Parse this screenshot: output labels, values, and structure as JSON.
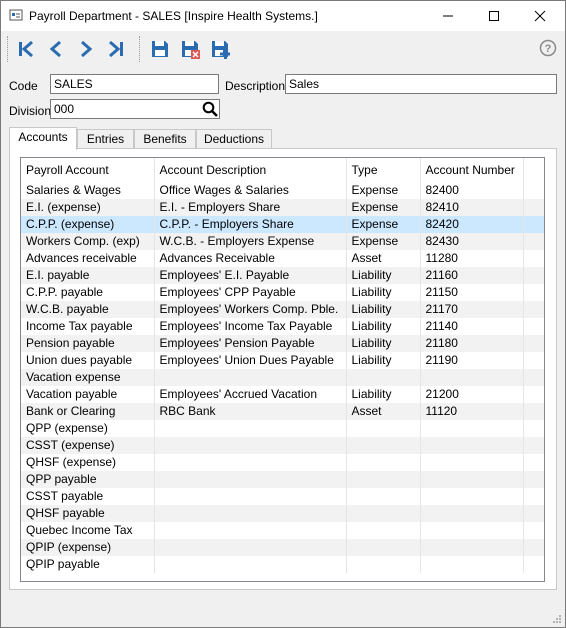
{
  "window": {
    "title": "Payroll Department - SALES [Inspire Health Systems.]",
    "controls": [
      "minimize",
      "maximize",
      "close"
    ]
  },
  "toolbar": {
    "buttons": [
      "first-record-icon",
      "previous-record-icon",
      "next-record-icon",
      "last-record-icon",
      "save-icon",
      "save-and-delete-icon",
      "save-and-new-icon"
    ],
    "help_label": "?"
  },
  "form": {
    "code_label": "Code",
    "code_value": "SALES",
    "description_label": "Description",
    "description_value": "Sales",
    "division_label": "Division",
    "division_value": "000"
  },
  "tabs": [
    {
      "label": "Accounts",
      "active": true
    },
    {
      "label": "Entries",
      "active": false
    },
    {
      "label": "Benefits",
      "active": false
    },
    {
      "label": "Deductions",
      "active": false
    }
  ],
  "grid": {
    "columns": [
      "Payroll Account",
      "Account Description",
      "Type",
      "Account Number"
    ],
    "rows": [
      [
        "Salaries & Wages",
        "Office Wages & Salaries",
        "Expense",
        "82400"
      ],
      [
        "E.I. (expense)",
        "E.I. - Employers Share",
        "Expense",
        "82410"
      ],
      [
        "C.P.P. (expense)",
        "C.P.P. - Employers Share",
        "Expense",
        "82420"
      ],
      [
        "Workers Comp. (exp)",
        "W.C.B. - Employers Expense",
        "Expense",
        "82430"
      ],
      [
        "Advances receivable",
        "Advances Receivable",
        "Asset",
        "11280"
      ],
      [
        "E.I. payable",
        "Employees' E.I. Payable",
        "Liability",
        "21160"
      ],
      [
        "C.P.P. payable",
        "Employees' CPP Payable",
        "Liability",
        "21150"
      ],
      [
        "W.C.B. payable",
        "Employees' Workers Comp. Pble.",
        "Liability",
        "21170"
      ],
      [
        "Income Tax payable",
        "Employees' Income Tax Payable",
        "Liability",
        "21140"
      ],
      [
        "Pension payable",
        "Employees' Pension Payable",
        "Liability",
        "21180"
      ],
      [
        "Union dues payable",
        "Employees' Union Dues Payable",
        "Liability",
        "21190"
      ],
      [
        "Vacation expense",
        "",
        "",
        ""
      ],
      [
        "Vacation payable",
        "Employees' Accrued Vacation",
        "Liability",
        "21200"
      ],
      [
        "Bank or Clearing",
        "RBC Bank",
        "Asset",
        "11120"
      ],
      [
        "QPP (expense)",
        "",
        "",
        ""
      ],
      [
        "CSST (expense)",
        "",
        "",
        ""
      ],
      [
        "QHSF (expense)",
        "",
        "",
        ""
      ],
      [
        "QPP payable",
        "",
        "",
        ""
      ],
      [
        "CSST payable",
        "",
        "",
        ""
      ],
      [
        "QHSF payable",
        "",
        "",
        ""
      ],
      [
        "Quebec Income Tax",
        "",
        "",
        ""
      ],
      [
        "QPIP (expense)",
        "",
        "",
        ""
      ],
      [
        "QPIP payable",
        "",
        "",
        ""
      ]
    ],
    "selected_row": 2
  },
  "colors": {
    "accent": "#2b6cb0",
    "selected_row": "#cce8ff",
    "alt_row": "#f2f2f2"
  }
}
